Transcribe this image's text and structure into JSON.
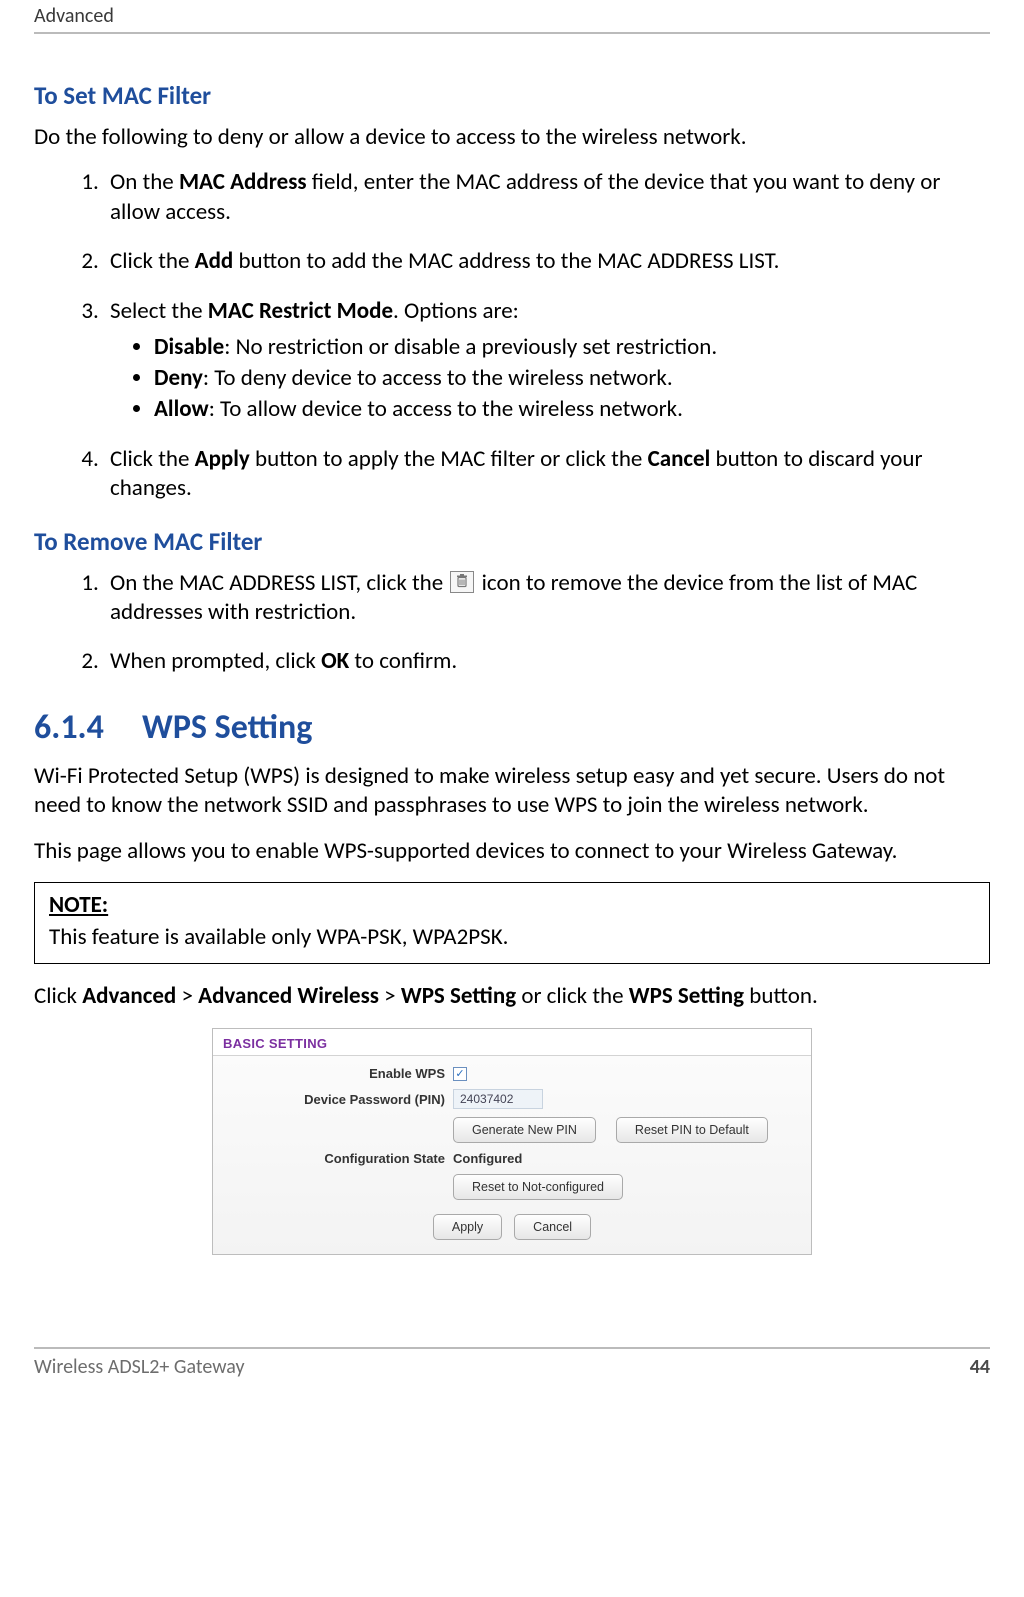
{
  "header": "Advanced",
  "footer": {
    "doc": "Wireless ADSL2+ Gateway",
    "page": "44"
  },
  "set": {
    "heading": "To Set MAC Filter",
    "intro": "Do the following to deny or allow a device to access to the wireless network.",
    "step1": {
      "pre": "On the ",
      "bold": "MAC Address",
      "post": " field, enter the MAC address of the device that you want to deny or allow access."
    },
    "step2": {
      "pre": "Click the ",
      "bold": "Add",
      "post": " button to add the MAC address to the MAC ADDRESS LIST."
    },
    "step3": {
      "pre": "Select the ",
      "bold": "MAC Restrict Mode",
      "post": ". Options are:"
    },
    "opt1": {
      "bold": "Disable",
      "post": ": No restriction or disable a previously set restriction."
    },
    "opt2": {
      "bold": "Deny",
      "post": ": To deny device to access to the wireless network."
    },
    "opt3": {
      "bold": "Allow",
      "post": ": To allow device to access to the wireless network."
    },
    "step4": {
      "pre": "Click the ",
      "bold1": "Apply",
      "mid": " button to apply the MAC filter or click the ",
      "bold2": "Cancel",
      "post": " button to discard your changes."
    }
  },
  "remove": {
    "heading": "To Remove MAC Filter",
    "step1": {
      "pre": "On the MAC ADDRESS LIST, click the ",
      "post": " icon to remove the device from the list of MAC addresses with restriction."
    },
    "step2": {
      "pre": "When prompted, click ",
      "bold": "OK",
      "post": " to confirm."
    }
  },
  "wps": {
    "num": "6.1.4",
    "title": "WPS Setting",
    "para1": "Wi-Fi Protected Setup (WPS) is designed to make wireless setup easy and yet secure. Users do not need to know the network SSID and passphrases to use WPS to join the wireless network.",
    "para2": "This page allows you to enable WPS-supported devices to connect to your Wireless Gateway.",
    "note_label": "NOTE:",
    "note_text": "This feature is available only WPA-PSK, WPA2PSK.",
    "nav": {
      "pre": "Click ",
      "a": "Advanced",
      "sep": " > ",
      "b": "Advanced Wireless",
      "c": "WPS Setting",
      "mid": " or click the ",
      "d": "WPS Setting",
      "post": " button."
    }
  },
  "panel": {
    "title": "BASIC SETTING",
    "enable_label": "Enable WPS",
    "enable_checked": true,
    "pin_label": "Device Password (PIN)",
    "pin_value": "24037402",
    "btn_gen": "Generate New PIN",
    "btn_reset_pin": "Reset PIN to Default",
    "cfg_label": "Configuration State",
    "cfg_value": "Configured",
    "btn_reset_cfg": "Reset to Not-configured",
    "btn_apply": "Apply",
    "btn_cancel": "Cancel"
  }
}
